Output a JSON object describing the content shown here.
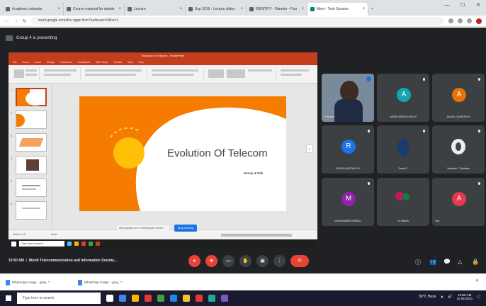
{
  "browser": {
    "tabs": [
      {
        "label": "Academic calendar"
      },
      {
        "label": "Course material for details"
      },
      {
        "label": "Lecture"
      },
      {
        "label": "Sep 2019 - Lecture slides"
      },
      {
        "label": "IDENTIFY - Wander - Pau"
      },
      {
        "label": "Meet - Tech Session"
      }
    ],
    "url": "meet.google.com/dsv-ogqz-hvm?authuser=0&hs=1"
  },
  "meet": {
    "presenting_label": "Group 4 is presenting",
    "meeting_time": "10:50 AM",
    "meeting_title": "World Telecommunication and Information Society..."
  },
  "ppt": {
    "window_title": "Evolution of Telecom - PowerPoint",
    "menu": [
      "File",
      "Home",
      "Insert",
      "Design",
      "Transitions",
      "Animations",
      "Slide Show",
      "Review",
      "View",
      "Help"
    ],
    "slide_title": "Evolution Of Telecom",
    "slide_subtitle": "Group 4 Talk",
    "status_left": "Slide 1 of 6",
    "status_notes": "Notes",
    "share_pill": "Stop sharing",
    "share_notice": "meet.google.com is sharing your screen.",
    "taskbar_search": "Type here to search"
  },
  "participants": [
    {
      "name": "Praveen",
      "initial": "",
      "color": "#5f6368",
      "video": true
    },
    {
      "name": "ARUN SEBASTIAN M",
      "initial": "A",
      "color": "#12a4af"
    },
    {
      "name": "ANJALI SURESH K",
      "initial": "A",
      "color": "#e8710a"
    },
    {
      "name": "ROHIN ANTONY M",
      "initial": "R",
      "color": "#1a73e8"
    },
    {
      "name": "Swati C",
      "initial": "",
      "color": "#1a3d6e",
      "video": true
    },
    {
      "name": "Santosh T Mathew",
      "initial": "",
      "color": "#ffffff",
      "video": true
    },
    {
      "name": "MOHAMMED BINSAL",
      "initial": "M",
      "color": "#8e24aa"
    },
    {
      "name": "10 others",
      "initial": "",
      "color": "#c2185b"
    },
    {
      "name": "You",
      "initial": "A",
      "color": "#e53950"
    }
  ],
  "downloads": [
    {
      "name": "WhatsApp Image....jpeg"
    },
    {
      "name": "WhatsApp Image....jpeg"
    }
  ],
  "windows": {
    "search_placeholder": "Type here to search",
    "tray_temp": "30°C Haze",
    "time": "10:50 AM",
    "date": "11-05-2021"
  }
}
